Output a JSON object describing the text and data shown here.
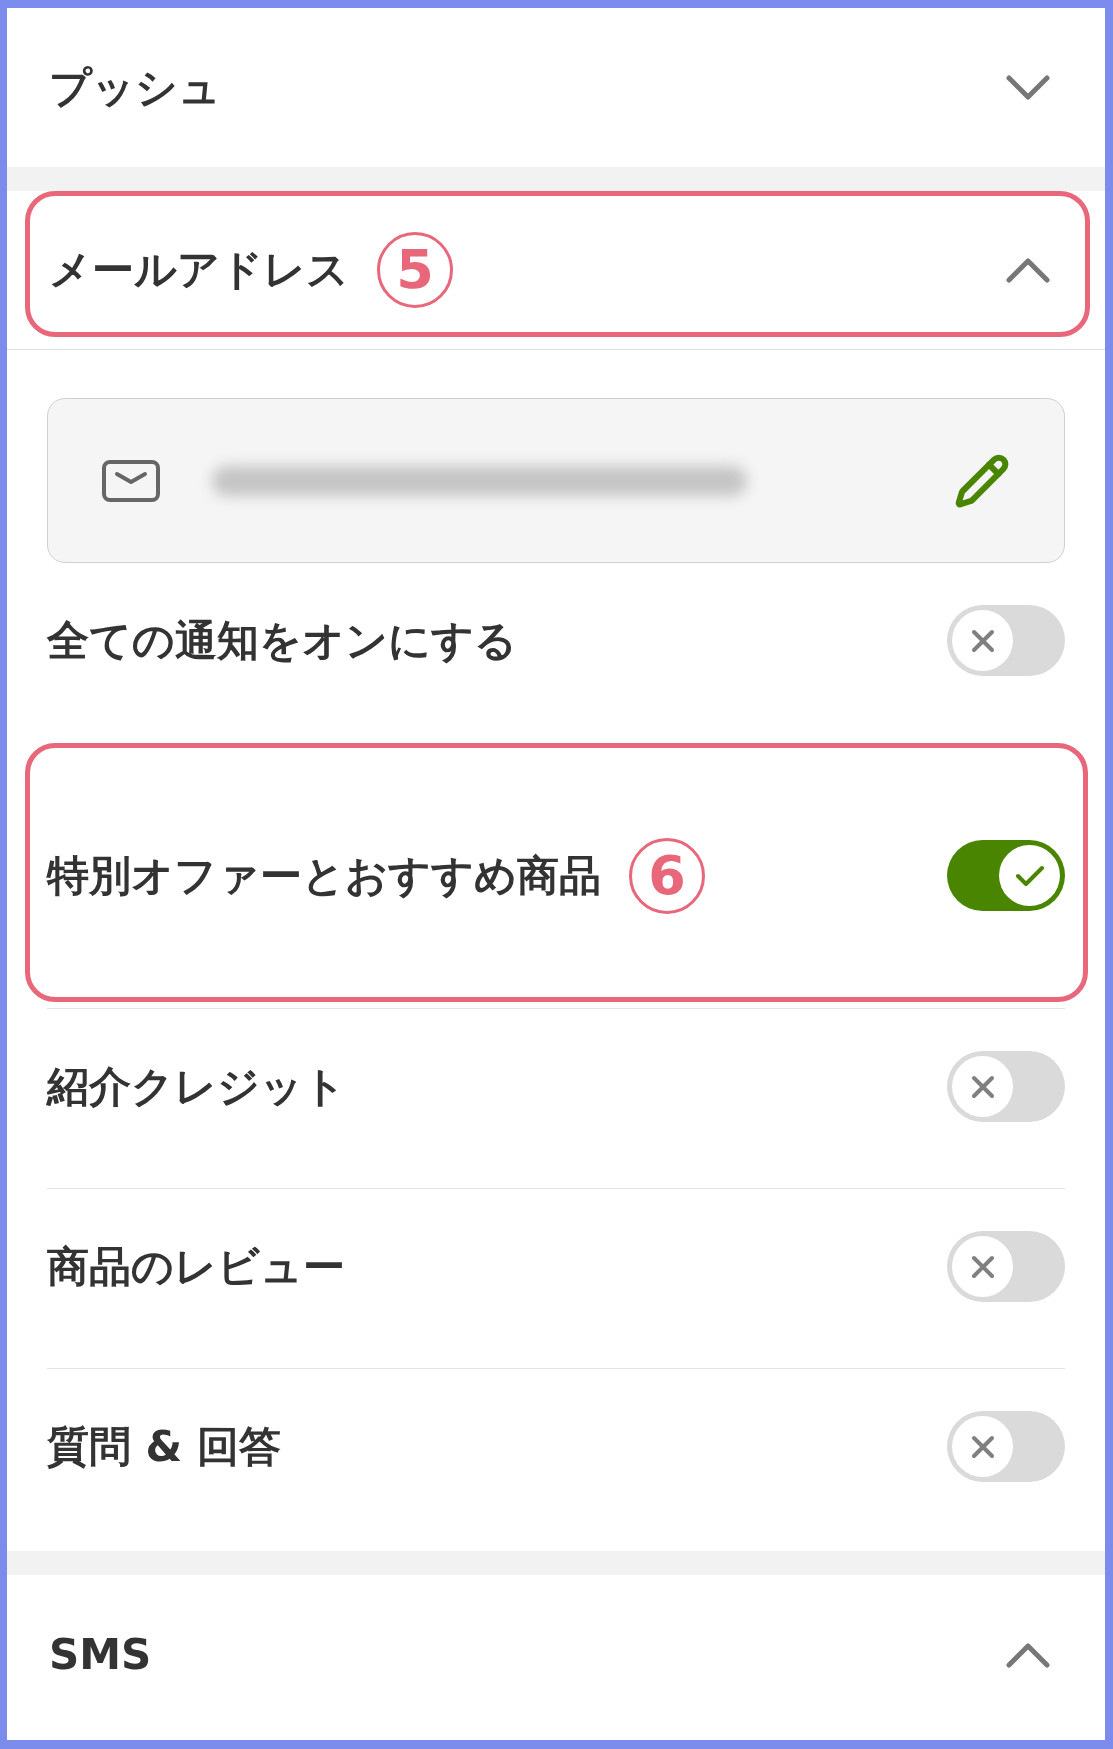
{
  "sections": [
    {
      "title": "プッシュ",
      "expanded": false
    },
    {
      "title": "メールアドレス",
      "expanded": true,
      "callout": "5",
      "email_field": {
        "redacted": true
      },
      "toggles": [
        {
          "label": "全ての通知をオンにする",
          "on": false
        },
        {
          "label": "特別オファーとおすすめ商品",
          "on": true,
          "callout": "6"
        },
        {
          "label": "紹介クレジット",
          "on": false
        },
        {
          "label": "商品のレビュー",
          "on": false
        },
        {
          "label": "質問 & 回答",
          "on": false
        }
      ]
    },
    {
      "title": "SMS",
      "expanded": true
    }
  ]
}
